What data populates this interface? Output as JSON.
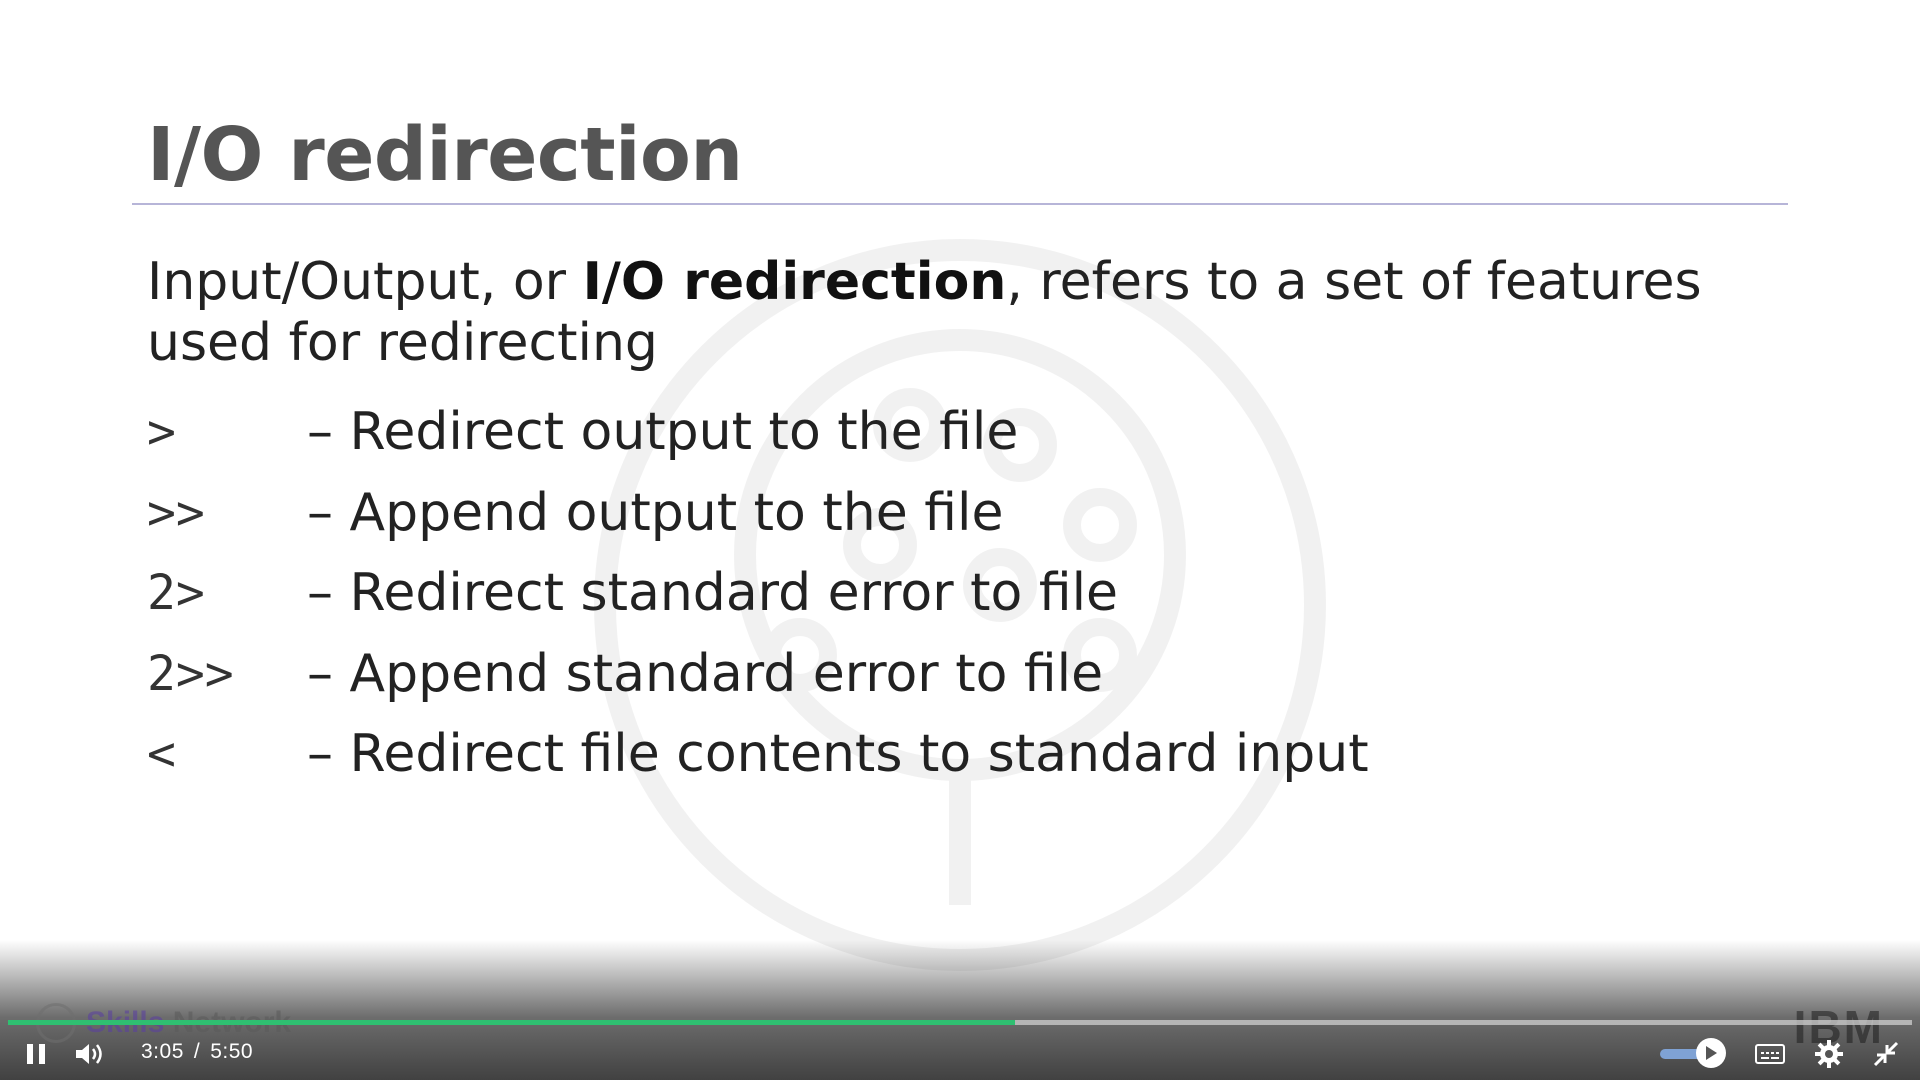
{
  "slide": {
    "title": "I/O redirection",
    "intro_prefix": "Input/Output, or ",
    "intro_bold": "I/O redirection",
    "intro_suffix": ", refers to a set of features used for redirecting",
    "operators": [
      {
        "symbol": ">",
        "description": "– Redirect output to the file"
      },
      {
        "symbol": ">>",
        "description": "– Append output to the file"
      },
      {
        "symbol": "2>",
        "description": "– Redirect standard error to file"
      },
      {
        "symbol": "2>>",
        "description": "– Append standard error to file"
      },
      {
        "symbol": "<",
        "description": "– Redirect file contents to standard input"
      }
    ]
  },
  "branding": {
    "left_skills": "Skills",
    "left_network": "Network",
    "right": "IBM"
  },
  "player": {
    "current_time": "3:05",
    "separator": "/",
    "duration": "5:50",
    "progress_fraction": 0.529,
    "progress_color": "#2fbf71",
    "play_state": "playing",
    "icons": {
      "pause": "pause-icon",
      "volume": "volume-icon",
      "autoplay": "autoplay-toggle-icon",
      "captions": "captions-icon",
      "settings": "gear-icon",
      "exit_fullscreen": "exit-fullscreen-icon"
    }
  }
}
